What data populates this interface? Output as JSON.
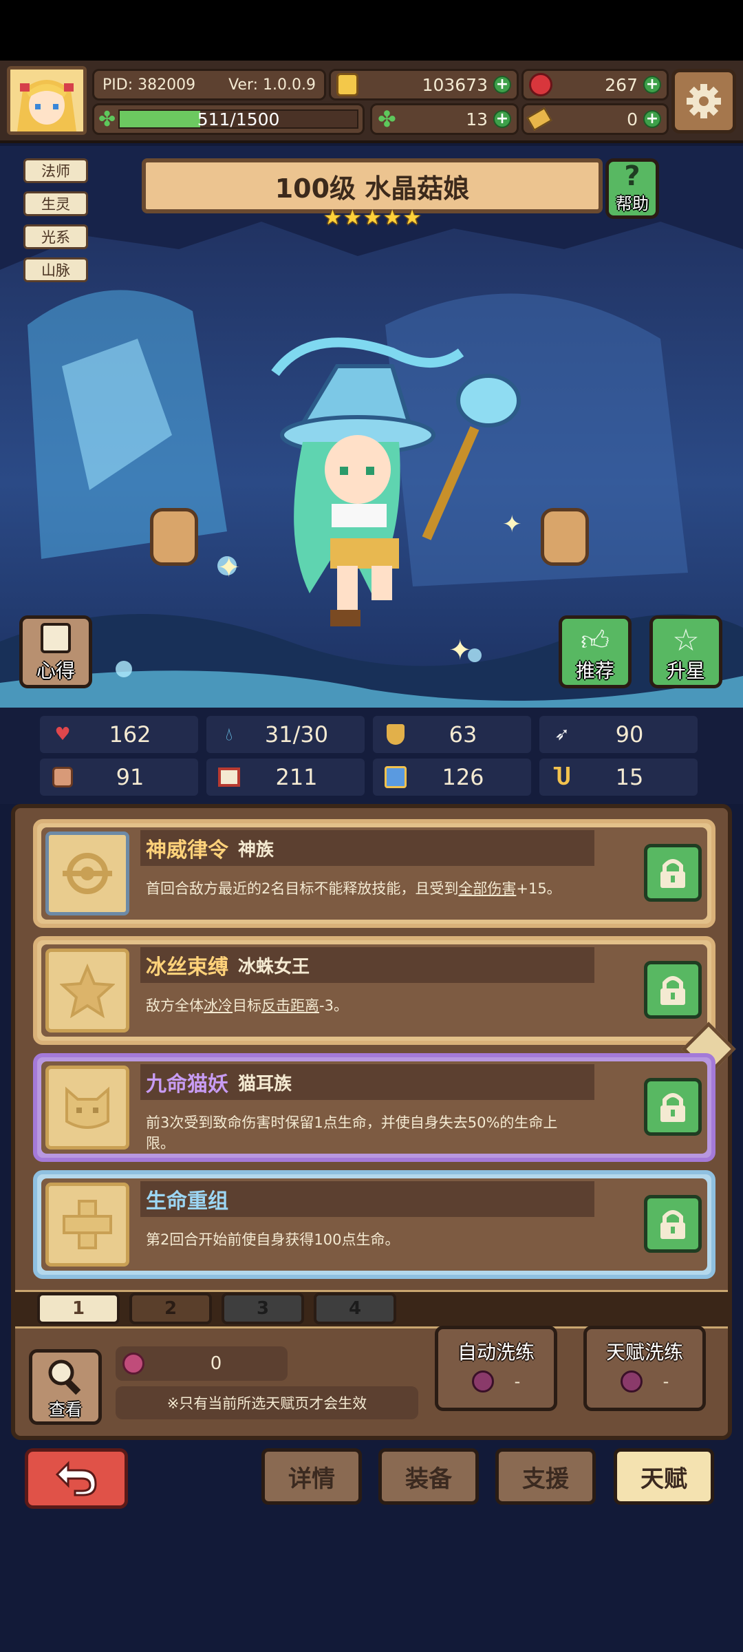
{
  "header": {
    "pid": "PID: 382009",
    "version": "Ver: 1.0.0.9",
    "gold": "103673",
    "gems": "267",
    "xp": "511/1500",
    "xp_fraction": 0.34,
    "clover": "13",
    "tickets": "0"
  },
  "hero": {
    "tags": [
      "法师",
      "生灵",
      "光系",
      "山脉"
    ],
    "title": "100级 水晶菇娘",
    "stars": 5,
    "help_label": "帮助",
    "notes_label": "心得",
    "recommend_label": "推荐",
    "star_up_label": "升星"
  },
  "stats": [
    {
      "icon": "heart-icon",
      "value": "162"
    },
    {
      "icon": "water-drop-icon",
      "value": "31/30"
    },
    {
      "icon": "shield-icon",
      "value": "63"
    },
    {
      "icon": "wing-icon",
      "value": "90"
    },
    {
      "icon": "fist-icon",
      "value": "91"
    },
    {
      "icon": "book-icon",
      "value": "211"
    },
    {
      "icon": "boot-icon",
      "value": "126"
    },
    {
      "icon": "horseshoe-icon",
      "value": "15"
    }
  ],
  "talents": [
    {
      "name": "神威律令",
      "race": "神族",
      "desc_pre": "首回合敌方最近的2名目标不能释放技能，且受到",
      "desc_link": "全部伤害",
      "desc_post": "+15。"
    },
    {
      "name": "冰丝束缚",
      "race": "冰蛛女王",
      "desc_pre": "敌方全体",
      "desc_link": "冰冷",
      "desc_mid": "目标",
      "desc_link2": "反击距离",
      "desc_post": "-3。"
    },
    {
      "name": "九命猫妖",
      "race": "猫耳族",
      "desc": "前3次受到致命伤害时保留1点生命，并使自身失去50%的生命上限。"
    },
    {
      "name": "生命重组",
      "race": "",
      "desc": "第2回合开始前使自身获得100点生命。"
    }
  ],
  "pages": [
    "1",
    "2",
    "3",
    "4"
  ],
  "bottom": {
    "view_label": "查看",
    "berry_count": "0",
    "notice": "※只有当前所选天赋页才会生效",
    "auto_refine_label": "自动洗练",
    "auto_refine_cost": "-",
    "talent_refine_label": "天赋洗练",
    "talent_refine_cost": "-"
  },
  "nav": {
    "details": "详情",
    "equipment": "装备",
    "support": "支援",
    "talent": "天赋"
  },
  "colors": {
    "accent_gold": "#ffd27a",
    "lock_green": "#58b862",
    "back_red": "#e05248",
    "purple_border": "#a47ad8",
    "blue_border": "#8fc0e0"
  }
}
